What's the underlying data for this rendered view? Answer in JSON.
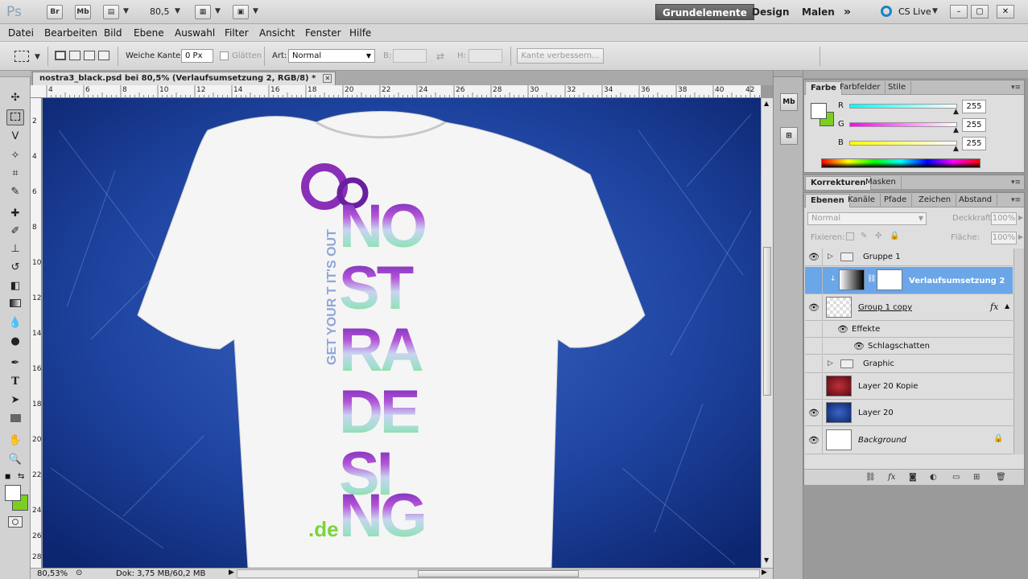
{
  "appbar": {
    "logo": "Ps",
    "bridge_label": "Br",
    "minibridge_label": "Mb",
    "zoom_value": "80,5",
    "workspaces": [
      "Grundelemente",
      "Design",
      "Malen"
    ],
    "more_label": "»",
    "cslive_label": "CS Live",
    "window_controls": [
      "–",
      "▢",
      "✕"
    ]
  },
  "menubar": {
    "items": [
      "Datei",
      "Bearbeiten",
      "Bild",
      "Ebene",
      "Auswahl",
      "Filter",
      "Ansicht",
      "Fenster",
      "Hilfe"
    ]
  },
  "options": {
    "feather_label": "Weiche Kante:",
    "feather_value": "0 Px",
    "antialias_label": "Glätten",
    "style_label": "Art:",
    "style_value": "Normal",
    "width_label": "B:",
    "height_label": "H:",
    "refine_edge_label": "Kante verbessern..."
  },
  "document": {
    "tab_title": "nostra3_black.psd bei 80,5% (Verlaufsumsetzung 2, RGB/8) *",
    "close_glyph": "✕",
    "ruler_h": [
      "4",
      "6",
      "8",
      "10",
      "12",
      "14",
      "16",
      "18",
      "20",
      "22",
      "24",
      "26",
      "28",
      "30",
      "32",
      "34",
      "36",
      "38",
      "40",
      "42"
    ],
    "ruler_v": [
      "2",
      "4",
      "6",
      "8",
      "10",
      "12",
      "14",
      "16",
      "18",
      "20",
      "22",
      "24",
      "26",
      "28"
    ],
    "status_zoom": "80,53%",
    "status_doc": "Dok: 3,75 MB/60,2 MB",
    "artwork": {
      "lines": [
        "NO",
        "ST",
        "RA",
        "DE",
        "SI",
        "NG"
      ],
      "side_text": "GET YOUR T IT'S OUT",
      "domain": ".de"
    }
  },
  "color_panel": {
    "tabs": [
      "Farbe",
      "Farbfelder",
      "Stile"
    ],
    "r_label": "R",
    "g_label": "G",
    "b_label": "B",
    "r_value": "255",
    "g_value": "255",
    "b_value": "255"
  },
  "adjust_panel": {
    "tabs": [
      "Korrekturen",
      "Masken"
    ]
  },
  "layers_panel": {
    "tabs": [
      "Ebenen",
      "Kanäle",
      "Pfade",
      "Zeichen",
      "Abstand"
    ],
    "blend_mode": "Normal",
    "opacity_label": "Deckkraft:",
    "opacity_value": "100%",
    "lock_label": "Fixieren:",
    "fill_label": "Fläche:",
    "fill_value": "100%",
    "layers": [
      {
        "name": "Gruppe 1"
      },
      {
        "name": "Verlaufsumsetzung 2"
      },
      {
        "name": "Group 1 copy"
      },
      {
        "name": "Effekte"
      },
      {
        "name": "Schlagschatten"
      },
      {
        "name": "Graphic"
      },
      {
        "name": "Layer 20 Kopie"
      },
      {
        "name": "Layer 20"
      },
      {
        "name": "Background"
      }
    ],
    "fx_label": "fx"
  },
  "colors": {
    "fg": "#ffffff",
    "bg": "#7bcf1e",
    "selection": "#6aa6e8",
    "canvas_blue": "#1e44a0"
  }
}
